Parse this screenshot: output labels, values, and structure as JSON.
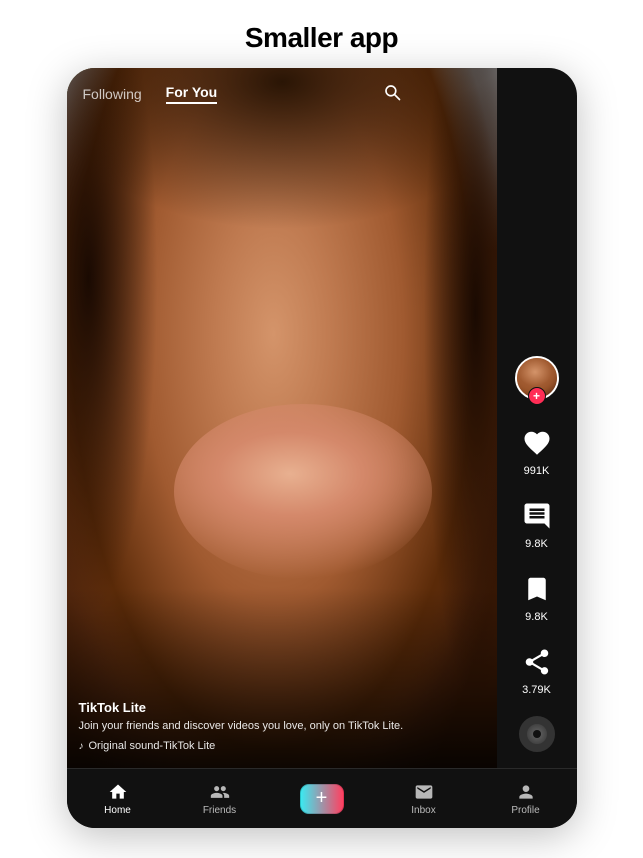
{
  "page": {
    "title": "Smaller app"
  },
  "header": {
    "following_tab": "Following",
    "for_you_tab": "For You",
    "active_tab": "for_you"
  },
  "video": {
    "creator_name": "TikTok Lite",
    "description": "Join your friends and discover videos you love, only on TikTok Lite.",
    "sound": "Original sound-TikTok Lite"
  },
  "actions": {
    "likes": "991K",
    "comments": "9.8K",
    "bookmarks": "9.8K",
    "shares": "3.79K"
  },
  "tabbar": {
    "home": "Home",
    "friends": "Friends",
    "inbox": "Inbox",
    "profile": "Profile"
  },
  "icons": {
    "search": "🔍",
    "home": "🏠",
    "friends": "👤👤",
    "inbox": "✉",
    "profile": "👤",
    "music": "♪",
    "plus": "+"
  }
}
